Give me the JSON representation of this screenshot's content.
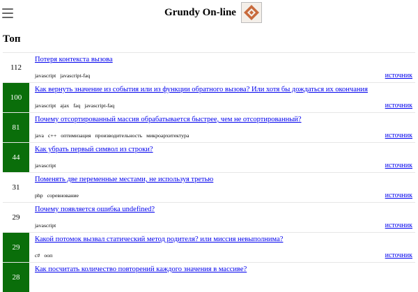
{
  "header": {
    "title": "Grundy On-line",
    "menu_icon": "hamburger-menu-icon",
    "logo_icon": "diamond-logo-icon",
    "logo_color": "#c86a3c"
  },
  "page": {
    "title": "Топ"
  },
  "colors": {
    "score_highlight": "#0a6e0a",
    "link": "#0000ee"
  },
  "questions": [
    {
      "score": "112",
      "highlight": false,
      "title": "Потеря контекста вызова",
      "tags": [
        "javascript",
        "javascript-faq"
      ],
      "source": "источник"
    },
    {
      "score": "100",
      "highlight": true,
      "title": "Как вернуть значение из события или из функции обратного вызова? Или хотя бы дождаться их окончания",
      "tags": [
        "javascript",
        "ajax",
        "faq",
        "javascript-faq"
      ],
      "source": "источник"
    },
    {
      "score": "81",
      "highlight": true,
      "title": "Почему отсортированный массив обрабатывается быстрее, чем не отсортированный?",
      "tags": [
        "java",
        "c++",
        "оптимизация",
        "производительность",
        "микроархитектура"
      ],
      "source": "источник"
    },
    {
      "score": "44",
      "highlight": true,
      "title": "Как убрать первый символ из строки?",
      "tags": [
        "javascript"
      ],
      "source": "источник"
    },
    {
      "score": "31",
      "highlight": false,
      "title": "Поменять две переменные местами, не используя третью",
      "tags": [
        "php",
        "соревнование"
      ],
      "source": "источник"
    },
    {
      "score": "29",
      "highlight": false,
      "title": "Почему появляется ошибка undefined?",
      "tags": [
        "javascript"
      ],
      "source": "источник"
    },
    {
      "score": "29",
      "highlight": true,
      "title": "Какой потомок вызвал статический метод родителя? или миссия невыполнима?",
      "tags": [
        "c#",
        "ооп"
      ],
      "source": "источник"
    },
    {
      "score": "28",
      "highlight": true,
      "title": "Как посчитать количество повторений каждого значения в массиве?",
      "tags": [],
      "source": ""
    }
  ]
}
